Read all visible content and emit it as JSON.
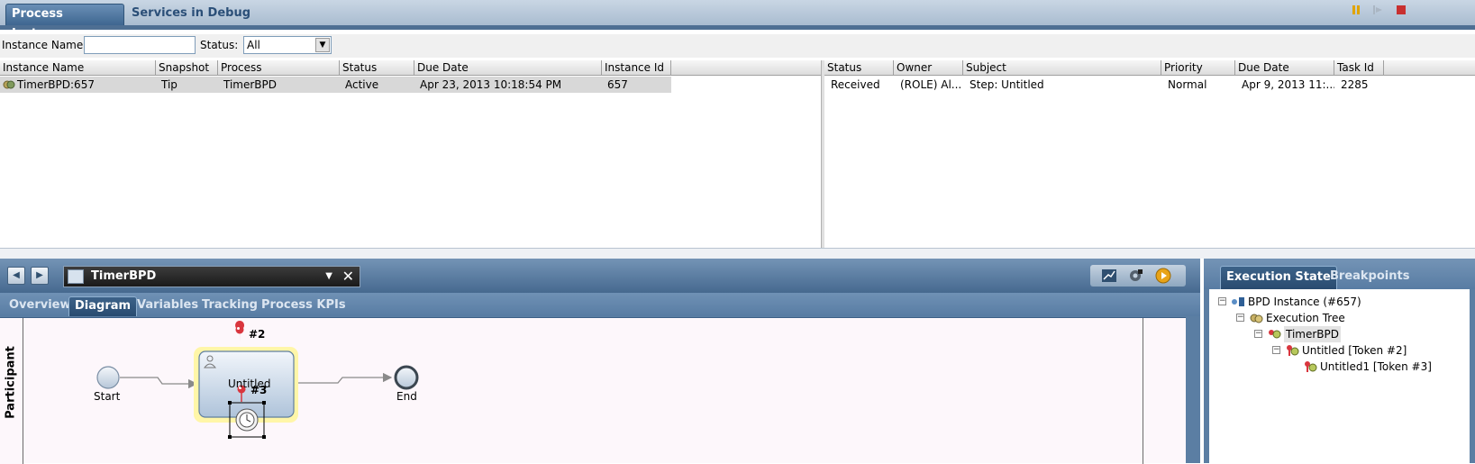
{
  "top_tabs": [
    "Process Instances",
    "Services in Debug"
  ],
  "filter": {
    "instance_name_label": "Instance Name:",
    "instance_name_value": "",
    "status_label": "Status:",
    "status_value": "All"
  },
  "instances_table": {
    "columns": [
      "Instance Name",
      "Snapshot",
      "Process",
      "Status",
      "Due Date",
      "Instance Id"
    ],
    "rows": [
      [
        "TimerBPD:657",
        "Tip",
        "TimerBPD",
        "Active",
        "Apr 23, 2013 10:18:54 PM",
        "657"
      ]
    ]
  },
  "tasks_table": {
    "columns": [
      "Status",
      "Owner",
      "Subject",
      "Priority",
      "Due Date",
      "Task Id"
    ],
    "rows": [
      [
        "Received",
        "(ROLE) Al...",
        "Step: Untitled",
        "Normal",
        "Apr 9, 2013 11:...",
        "2285"
      ]
    ]
  },
  "diagram_panel": {
    "process_name": "TimerBPD",
    "tabs": [
      "Overview",
      "Diagram",
      "Variables",
      "Tracking",
      "Process KPIs"
    ],
    "active_tab": "Diagram",
    "lane": "Participant",
    "start_label": "Start",
    "end_label": "End",
    "activity_label": "Untitled",
    "token_markers": [
      "#2",
      "#3"
    ]
  },
  "execution_panel": {
    "tabs": [
      "Execution State",
      "Breakpoints"
    ],
    "active_tab": "Execution State",
    "tree": [
      {
        "label": "BPD Instance (#657)",
        "icon": "bpd-instance-icon",
        "depth": 0,
        "toggle": "−"
      },
      {
        "label": "Execution Tree",
        "icon": "execution-tree-icon",
        "depth": 1,
        "toggle": "−"
      },
      {
        "label": "TimerBPD",
        "icon": "process-tokens-icon",
        "depth": 2,
        "toggle": "−",
        "selected": true
      },
      {
        "label": "Untitled [Token #2]",
        "icon": "token-icon",
        "depth": 3,
        "toggle": "−"
      },
      {
        "label": "Untitled1 [Token #3]",
        "icon": "token-icon",
        "depth": 4,
        "toggle": ""
      }
    ]
  },
  "colors": {
    "panel_blue": "#5b7ea3",
    "tab_active": "#3c6289",
    "task_highlight": "#fff6a8",
    "token_red": "#d9363e"
  }
}
